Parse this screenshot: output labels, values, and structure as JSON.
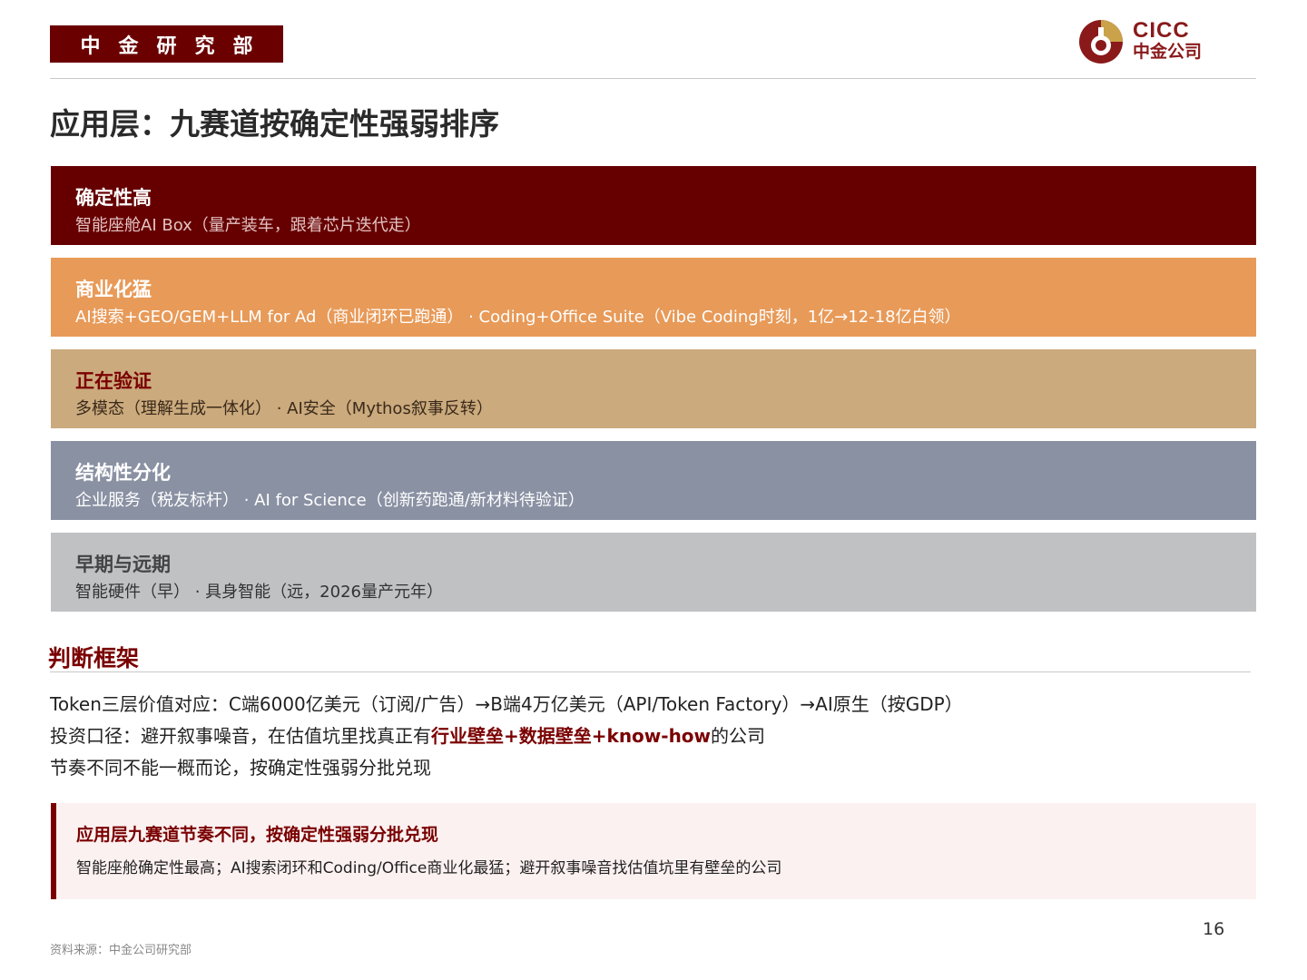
{
  "header": {
    "department": "中金研究部",
    "logo_en": "CICC",
    "logo_cn": "中金公司"
  },
  "title": "应用层：九赛道按确定性强弱排序",
  "tiers": [
    {
      "title": "确定性高",
      "desc": "智能座舱AI Box（量产装车，跟着芯片迭代走）",
      "bg": "#660000",
      "title_color": "#ffffff",
      "desc_color": "#e3c2c2"
    },
    {
      "title": "商业化猛",
      "desc": "AI搜索+GEO/GEM+LLM for Ad（商业闭环已跑通） · Coding+Office Suite（Vibe Coding时刻，1亿→12-18亿白领）",
      "bg": "#e89a58",
      "title_color": "#ffffff",
      "desc_color": "#ffffff"
    },
    {
      "title": "正在验证",
      "desc": "多模态（理解生成一体化） · AI安全（Mythos叙事反转）",
      "bg": "#cbaa7d",
      "title_color": "#7a0000",
      "desc_color": "#3a2a1a"
    },
    {
      "title": "结构性分化",
      "desc": "企业服务（税友标杆） · AI for Science（创新药跑通/新材料待验证）",
      "bg": "#8a91a3",
      "title_color": "#ffffff",
      "desc_color": "#ffffff"
    },
    {
      "title": "早期与远期",
      "desc": "智能硬件（早） · 具身智能（远，2026量产元年）",
      "bg": "#bfc1c3",
      "title_color": "#444444",
      "desc_color": "#333333"
    }
  ],
  "framework": {
    "heading": "判断框架",
    "line1": "Token三层价值对应：C端6000亿美元（订阅/广告）→B端4万亿美元（API/Token Factory）→AI原生（按GDP）",
    "line2_pre": "投资口径：避开叙事噪音，在估值坑里找真正有",
    "line2_emph": "行业壁垒+数据壁垒+know-how",
    "line2_post": "的公司",
    "line3": "节奏不同不能一概而论，按确定性强弱分批兑现"
  },
  "callout": {
    "title": "应用层九赛道节奏不同，按确定性强弱分批兑现",
    "body": "智能座舱确定性最高；AI搜索闭环和Coding/Office商业化最猛；避开叙事噪音找估值坑里有壁垒的公司"
  },
  "footer": {
    "page_number": "16",
    "source": "资料来源：中金公司研究部"
  },
  "colors": {
    "brand": "#6b0000",
    "accent": "#7a0000"
  }
}
